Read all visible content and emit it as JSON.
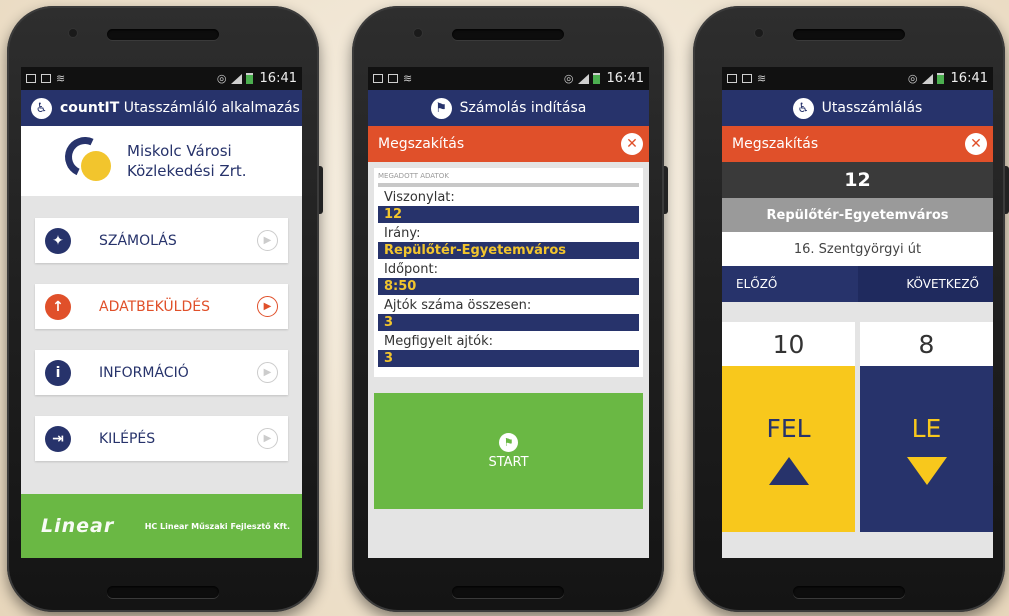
{
  "status": {
    "time": "16:41"
  },
  "phone1": {
    "appbar_title_bold": "countIT",
    "appbar_title_rest": " Utasszámláló alkalmazás",
    "logo_line1": "Miskolc Városi",
    "logo_line2": "Közlekedési Zrt.",
    "menu": [
      {
        "label": "SZÁMOLÁS",
        "icon": "person-walking-icon"
      },
      {
        "label": "ADATBEKÜLDÉS",
        "icon": "upload-arrow-icon"
      },
      {
        "label": "INFORMÁCIÓ",
        "icon": "info-icon"
      },
      {
        "label": "KILÉPÉS",
        "icon": "exit-icon"
      }
    ],
    "footer_logo": "Linear",
    "footer_text": "HC Linear Műszaki Fejlesztő Kft."
  },
  "phone2": {
    "appbar_title": "Számolás indítása",
    "cancel_label": "Megszakítás",
    "section_header": "MEGADOTT ADATOK",
    "fields": [
      {
        "label": "Viszonylat:",
        "value": "12"
      },
      {
        "label": "Irány:",
        "value": "Repülőtér-Egyetemváros"
      },
      {
        "label": "Időpont:",
        "value": "8:50"
      },
      {
        "label": "Ajtók száma összesen:",
        "value": "3"
      },
      {
        "label": "Megfigyelt ajtók:",
        "value": "3"
      }
    ],
    "start_label": "START"
  },
  "phone3": {
    "appbar_title": "Utasszámlálás",
    "cancel_label": "Megszakítás",
    "route": "12",
    "destination": "Repülőtér-Egyetemváros",
    "stop": "16. Szentgyörgyi út",
    "prev_label": "ELŐZŐ",
    "next_label": "KÖVETKEZŐ",
    "board_count": "10",
    "alight_count": "8",
    "board_label": "FEL",
    "alight_label": "LE"
  },
  "colors": {
    "navy": "#27336b",
    "orange": "#e0502a",
    "green": "#6ab844",
    "yellow": "#f8c81c"
  }
}
